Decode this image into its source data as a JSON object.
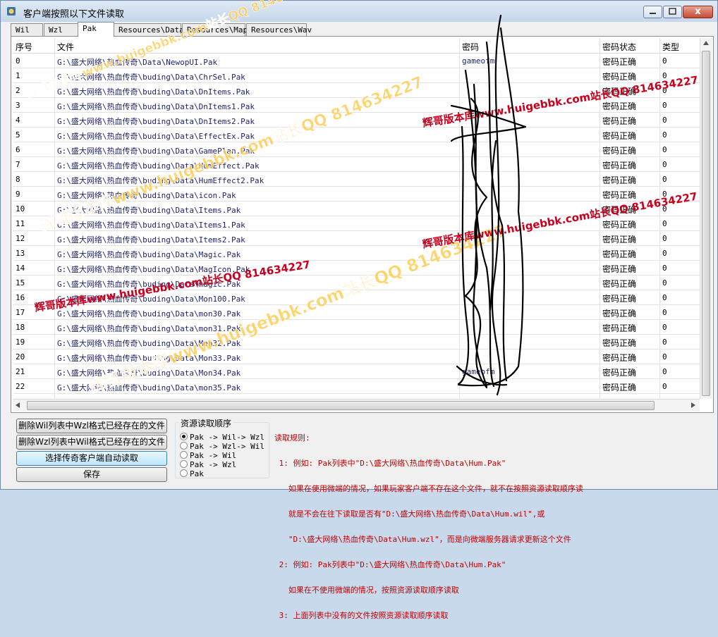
{
  "window": {
    "title": "客户端按照以下文件读取",
    "close_glyph": "x"
  },
  "tabs": [
    "Wil",
    "Wzl",
    "Pak",
    "Resources\\Data",
    "Resources\\Map",
    "Resources\\Wav"
  ],
  "active_tab": "Pak",
  "table": {
    "columns": [
      "序号",
      "文件",
      "密码",
      "密码状态",
      "类型"
    ],
    "rows": [
      {
        "idx": "0",
        "file": "G:\\盛大网络\\热血传奇\\Data\\NewopUI.Pak",
        "pwd": "gameofm",
        "status": "密码正确",
        "type": "0"
      },
      {
        "idx": "1",
        "file": "G:\\盛大网络\\热血传奇\\buding\\Data\\ChrSel.Pak",
        "pwd": "",
        "status": "密码正确",
        "type": "0"
      },
      {
        "idx": "2",
        "file": "G:\\盛大网络\\热血传奇\\buding\\Data\\DnItems.Pak",
        "pwd": "",
        "status": "密码正确",
        "type": "0"
      },
      {
        "idx": "3",
        "file": "G:\\盛大网络\\热血传奇\\buding\\Data\\DnItems1.Pak",
        "pwd": "",
        "status": "密码正确",
        "type": "0"
      },
      {
        "idx": "4",
        "file": "G:\\盛大网络\\热血传奇\\buding\\Data\\DnItems2.Pak",
        "pwd": "",
        "status": "密码正确",
        "type": "0"
      },
      {
        "idx": "5",
        "file": "G:\\盛大网络\\热血传奇\\buding\\Data\\EffectEx.Pak",
        "pwd": "",
        "status": "密码正确",
        "type": "0"
      },
      {
        "idx": "6",
        "file": "G:\\盛大网络\\热血传奇\\buding\\Data\\GamePlan.Pak",
        "pwd": "",
        "status": "密码正确",
        "type": "0"
      },
      {
        "idx": "7",
        "file": "G:\\盛大网络\\热血传奇\\buding\\Data\\HumEffect.Pak",
        "pwd": "",
        "status": "密码正确",
        "type": "0"
      },
      {
        "idx": "8",
        "file": "G:\\盛大网络\\热血传奇\\buding\\Data\\HumEffect2.Pak",
        "pwd": "",
        "status": "密码正确",
        "type": "0"
      },
      {
        "idx": "9",
        "file": "G:\\盛大网络\\热血传奇\\buding\\Data\\icon.Pak",
        "pwd": "",
        "status": "密码正确",
        "type": "0"
      },
      {
        "idx": "10",
        "file": "G:\\盛大网络\\热血传奇\\buding\\Data\\Items.Pak",
        "pwd": "",
        "status": "密码正确",
        "type": "0"
      },
      {
        "idx": "11",
        "file": "G:\\盛大网络\\热血传奇\\buding\\Data\\Items1.Pak",
        "pwd": "",
        "status": "密码正确",
        "type": "0"
      },
      {
        "idx": "12",
        "file": "G:\\盛大网络\\热血传奇\\buding\\Data\\Items2.Pak",
        "pwd": "",
        "status": "密码正确",
        "type": "0"
      },
      {
        "idx": "13",
        "file": "G:\\盛大网络\\热血传奇\\buding\\Data\\Magic.Pak",
        "pwd": "",
        "status": "密码正确",
        "type": "0"
      },
      {
        "idx": "14",
        "file": "G:\\盛大网络\\热血传奇\\buding\\Data\\MagIcon.Pak",
        "pwd": "",
        "status": "密码正确",
        "type": "0"
      },
      {
        "idx": "15",
        "file": "G:\\盛大网络\\热血传奇\\buding\\Data\\magic.Pak",
        "pwd": "",
        "status": "密码正确",
        "type": "0"
      },
      {
        "idx": "16",
        "file": "G:\\盛大网络\\热血传奇\\buding\\Data\\Mon100.Pak",
        "pwd": "",
        "status": "密码正确",
        "type": "0"
      },
      {
        "idx": "17",
        "file": "G:\\盛大网络\\热血传奇\\buding\\Data\\mon30.Pak",
        "pwd": "",
        "status": "密码正确",
        "type": "0"
      },
      {
        "idx": "18",
        "file": "G:\\盛大网络\\热血传奇\\buding\\Data\\mon31.Pak",
        "pwd": "",
        "status": "密码正确",
        "type": "0"
      },
      {
        "idx": "19",
        "file": "G:\\盛大网络\\热血传奇\\buding\\Data\\Mon32.Pak",
        "pwd": "",
        "status": "密码正确",
        "type": "0"
      },
      {
        "idx": "20",
        "file": "G:\\盛大网络\\热血传奇\\buding\\Data\\Mon33.Pak",
        "pwd": "",
        "status": "密码正确",
        "type": "0"
      },
      {
        "idx": "21",
        "file": "G:\\盛大网络\\热血传奇\\buding\\Data\\Mon34.Pak",
        "pwd": "gameofm",
        "status": "密码正确",
        "type": "0"
      },
      {
        "idx": "22",
        "file": "G:\\盛大网络\\热血传奇\\buding\\Data\\mon35.Pak",
        "pwd": "",
        "status": "密码正确",
        "type": "0"
      }
    ]
  },
  "buttons": {
    "delete_wil": "删除Wil列表中Wzl格式已经存在的文件",
    "delete_wzl": "删除Wzl列表中Wil格式已经存在的文件",
    "auto_read": "选择传奇客户端自动读取",
    "save": "保存"
  },
  "read_order": {
    "title": "资源读取顺序",
    "options": [
      "Pak -> Wil-> Wzl",
      "Pak -> Wzl-> Wil",
      "Pak -> Wil",
      "Pak -> Wzl",
      "Pak"
    ],
    "selected": 0
  },
  "rules": [
    "读取规则:",
    " 1: 例如: Pak列表中\"D:\\盛大网络\\热血传奇\\Data\\Hum.Pak\"",
    "   如果在使用微端的情况，如果玩家客户端不存在这个文件，就不在按照资源读取顺序读",
    "   就是不会在往下读取是否有\"D:\\盛大网络\\热血传奇\\Data\\Hum.wil\",或",
    "   \"D:\\盛大网络\\热血传奇\\Data\\Hum.wzl\"，而是向微端服务器请求更新这个文件",
    " 2: 例如: Pak列表中\"D:\\盛大网络\\热血传奇\\Data\\Hum.Pak\"",
    "   如果在不使用微端的情况，按照资源读取顺序读取",
    " 3: 上面列表中没有的文件按照资源读取顺序读取"
  ],
  "watermarks": [
    "辉哥版本库www.huigebbk.com站长QQ 814634227",
    "辉哥版本库www.huigebbk.com站长QQ 814634227",
    "辉哥版本库www.huigebbk.com站长QQ 814634227",
    "辉哥版本库www.huigebbk.com站长QQ 814634227",
    "辉哥版本库www.huigebbk.com站长QQ 814634227",
    "辉哥版本库www.huigebbk.com站长QQ 814634227"
  ],
  "colors": {
    "watermark": "#ffc94a",
    "watermark_red": "#c8001e",
    "rules_text": "#c00000"
  }
}
